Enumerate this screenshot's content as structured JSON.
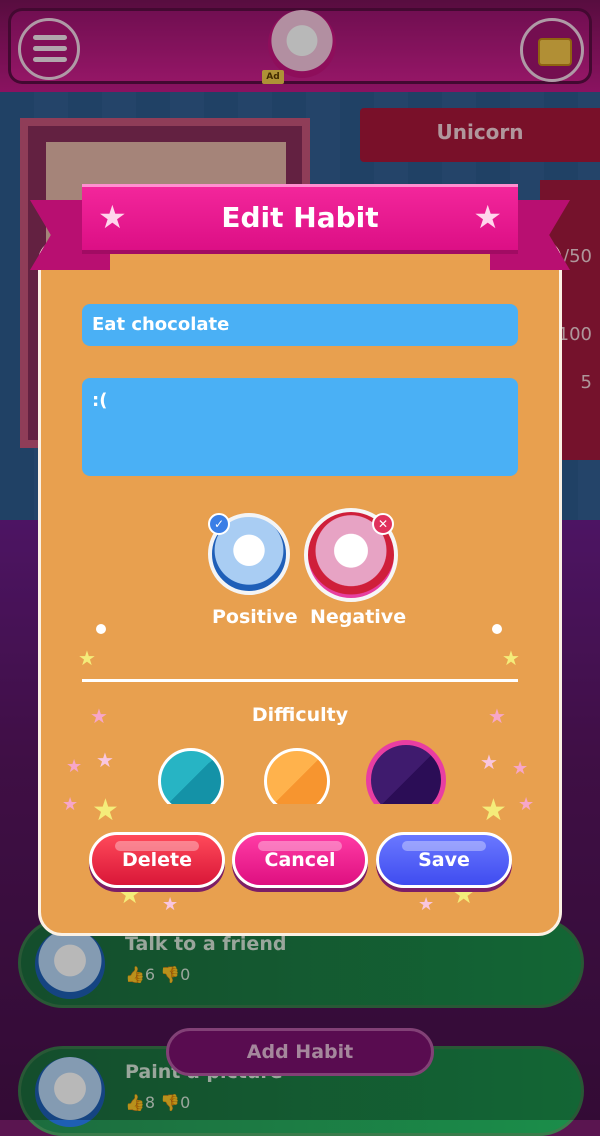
{
  "header": {
    "menu_icon": "hamburger-menu-icon",
    "avatar_icon": "unicorn-avatar",
    "ad_label": "Ad",
    "chest_icon": "treasure-chest-icon"
  },
  "background": {
    "pet_name": "Unicorn",
    "stats": [
      "/50",
      "100",
      "5"
    ],
    "habits": [
      {
        "title": "Talk to a friend",
        "likes": "6",
        "dislikes": "0"
      },
      {
        "title": "Paint a picture",
        "likes": "8",
        "dislikes": "0"
      }
    ],
    "add_habit_label": "Add Habit"
  },
  "dialog": {
    "title": "Edit Habit",
    "habit_name_value": "Eat chocolate",
    "habit_notes_value": ":(",
    "type_options": [
      {
        "label": "Positive",
        "selected": false,
        "badge": "check"
      },
      {
        "label": "Negative",
        "selected": true,
        "badge": "x"
      }
    ],
    "difficulty_label": "Difficulty",
    "difficulty_options": [
      {
        "name": "easy",
        "color": "#27b4c4",
        "selected": false
      },
      {
        "name": "medium",
        "color": "#ffb24c",
        "selected": false
      },
      {
        "name": "hard",
        "color": "#3f1b6e",
        "selected": true
      }
    ],
    "buttons": {
      "delete": "Delete",
      "cancel": "Cancel",
      "save": "Save"
    }
  },
  "colors": {
    "dialog_bg": "#e8a04f",
    "ribbon": "#dc0f85",
    "field_bg": "#4ab0f5",
    "delete": "#d91638",
    "cancel": "#de0f80",
    "save": "#3f4cf0"
  }
}
